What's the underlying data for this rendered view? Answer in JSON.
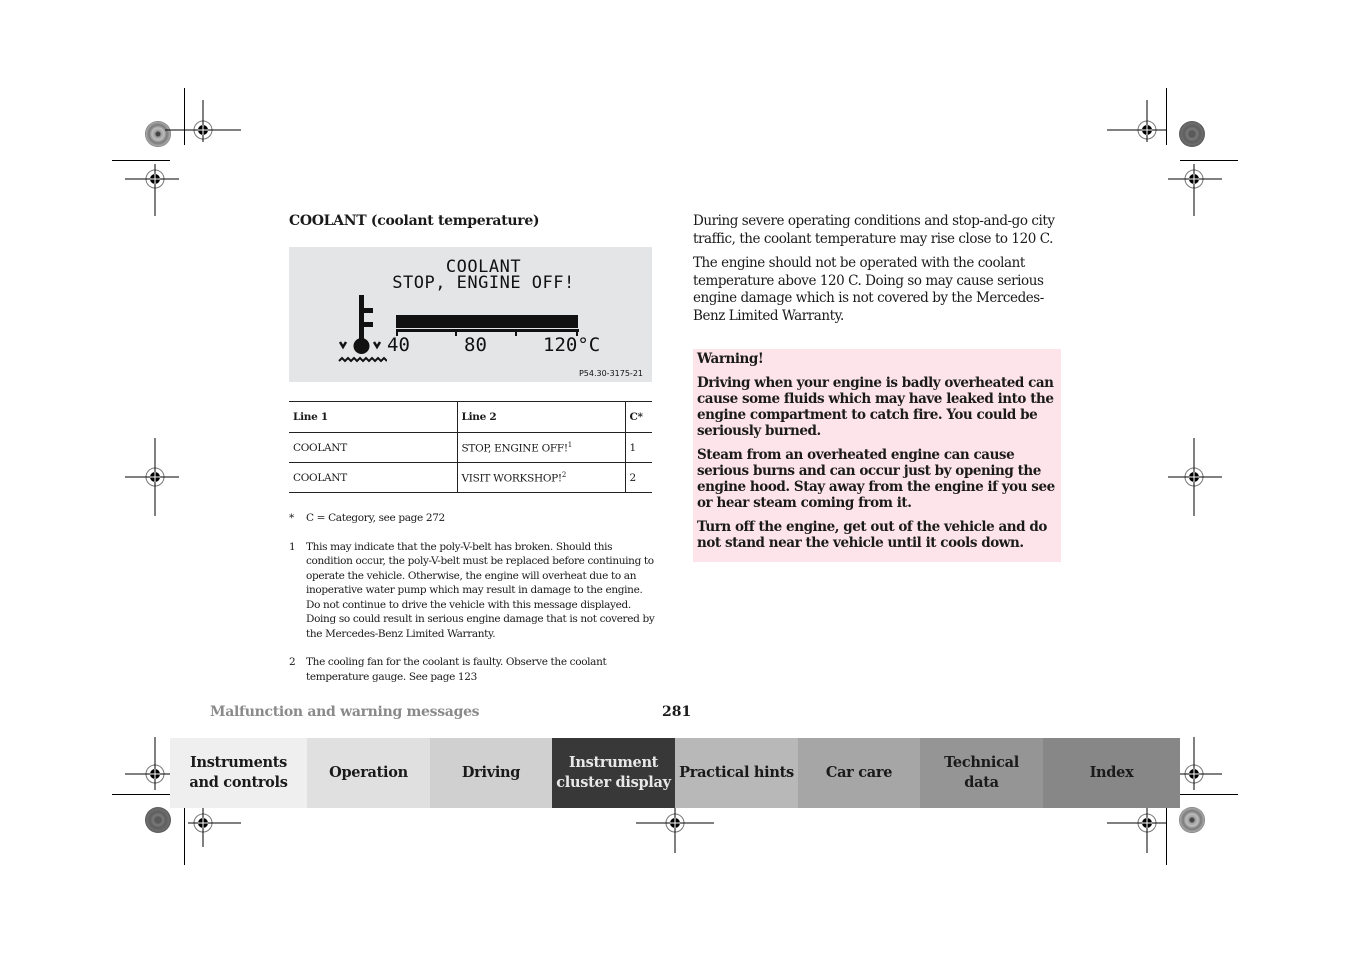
{
  "section_title": "COOLANT (coolant temperature)",
  "display": {
    "line1": "COOLANT",
    "line2": "STOP, ENGINE OFF!",
    "gauge_labels": [
      "40",
      "80",
      "120°C"
    ],
    "gauge_fill_fraction": 1.0,
    "figure_code": "P54.30-3175-21",
    "icon": "coolant-temperature-icon"
  },
  "table": {
    "headers": [
      "Line 1",
      "Line 2",
      "C*"
    ],
    "rows": [
      {
        "line1": "COOLANT",
        "line2": "STOP, ENGINE OFF!",
        "line2_note": "1",
        "category": "1"
      },
      {
        "line1": "COOLANT",
        "line2": "VISIT WORKSHOP!",
        "line2_note": "2",
        "category": "2"
      }
    ]
  },
  "footnotes": [
    {
      "marker": "*",
      "text": "C = Category, see page 272"
    },
    {
      "marker": "1",
      "text": "This may indicate that the poly-V-belt has broken. Should this condition occur, the poly-V-belt must be replaced before continuing to operate the vehicle. Otherwise, the engine will overheat due to an inoperative water pump which may result in damage to the engine. Do not continue to drive the vehicle with this message displayed. Doing so could result in serious engine damage that is not covered by the Mercedes-Benz Limited Warranty."
    },
    {
      "marker": "2",
      "text": "The cooling fan for the coolant is faulty. Observe the coolant temperature gauge. See page 123"
    }
  ],
  "body_paragraphs": [
    "During severe operating conditions and stop-and-go city traffic, the coolant temperature may rise close to 120 C.",
    "The engine should not be operated with the coolant temperature above 120 C. Doing so may cause serious engine damage which is not covered by the Mercedes-Benz Limited Warranty."
  ],
  "warning": {
    "title": "Warning!",
    "paragraphs": [
      "Driving when your engine is badly overheated can cause some fluids which may have leaked into the engine compartment to catch fire. You could be seriously burned.",
      "Steam from an overheated engine can cause serious burns and can occur just by opening the engine hood. Stay away from the engine if you see or hear steam coming from it.",
      "Turn off the engine, get out of the vehicle and do not stand near the vehicle until it cools down."
    ],
    "background": "#fde4ea"
  },
  "footer": {
    "section_name": "Malfunction and warning messages",
    "page_number": "281"
  },
  "nav_tabs": [
    {
      "line1": "Instruments",
      "line2": "and controls",
      "bg": "#efefef",
      "active": false
    },
    {
      "line1": "Operation",
      "line2": "",
      "bg": "#e0e0e0",
      "active": false
    },
    {
      "line1": "Driving",
      "line2": "",
      "bg": "#d0d0d0",
      "active": false
    },
    {
      "line1": "Instrument",
      "line2": "cluster display",
      "bg": "#383838",
      "active": true
    },
    {
      "line1": "Practical hints",
      "line2": "",
      "bg": "#b8b8b8",
      "active": false
    },
    {
      "line1": "Car care",
      "line2": "",
      "bg": "#a6a6a6",
      "active": false
    },
    {
      "line1": "Technical",
      "line2": "data",
      "bg": "#959595",
      "active": false
    },
    {
      "line1": "Index",
      "line2": "",
      "bg": "#878787",
      "active": false
    }
  ]
}
